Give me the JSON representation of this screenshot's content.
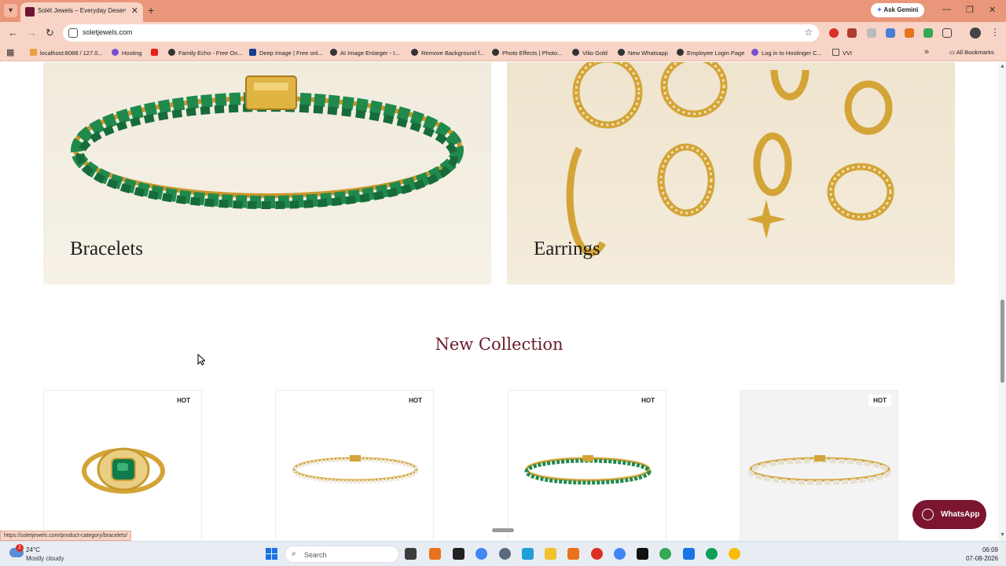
{
  "browser": {
    "tab_title": "Solét Jewels – Everyday Deserves",
    "url": "soletjewels.com",
    "gemini_label": "Ask Gemini",
    "new_tab": "+",
    "bookmarks": [
      "localhost:8088 / 127.0...",
      "Hosting",
      "Family Echo - Free On...",
      "Deep Image | Free onl...",
      "AI Image Enlarger - I...",
      "Remove Background f...",
      "Photo Effects | Photo...",
      "Vilio Gold",
      "New Whatsapp",
      "Employee Login Page",
      "Log in to Hostinger C...",
      "VVI"
    ],
    "all_bookmarks": "All Bookmarks",
    "status_url": "https://soletjewels.com/product-category/bracelets/"
  },
  "categories": [
    {
      "label": "Bracelets"
    },
    {
      "label": "Earrings"
    }
  ],
  "new_collection": {
    "title": "New Collection",
    "products": [
      {
        "badge": "HOT",
        "kind": "emerald ring"
      },
      {
        "badge": "HOT",
        "kind": "diamond tennis bracelet"
      },
      {
        "badge": "HOT",
        "kind": "emerald tennis bracelet"
      },
      {
        "badge": "HOT",
        "kind": "baguette diamond bracelet"
      }
    ]
  },
  "whatsapp": {
    "label": "WhatsApp"
  },
  "taskbar": {
    "weather_temp": "24°C",
    "weather_cond": "Mostly cloudy",
    "weather_badge": "1",
    "search_placeholder": "Search",
    "time": "06:09",
    "date": "07-08-2026"
  },
  "colors": {
    "tabbar": "#e9967a",
    "toolbar": "#f8d4c6",
    "brand": "#6a1b2b",
    "whatsapp_button": "#7b1530",
    "emerald": "#1f8a4c",
    "gold": "#d4a437"
  }
}
